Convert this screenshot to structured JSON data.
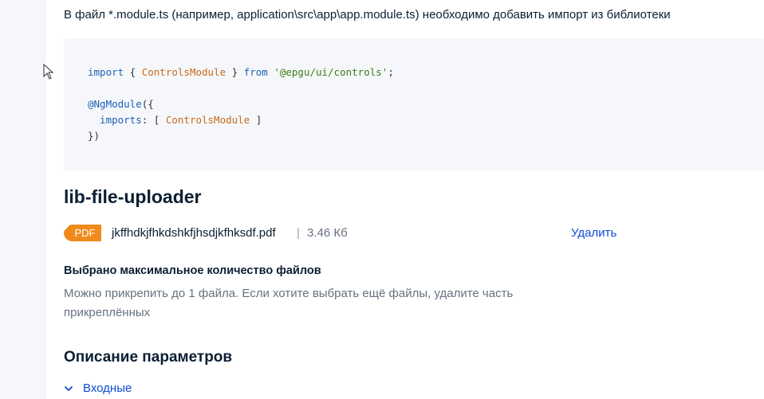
{
  "intro": {
    "text": "В файл *.module.ts (например, application\\src\\app\\app.module.ts) необходимо добавить импорт из библиотеки"
  },
  "code": {
    "line1": {
      "kw_import": "import",
      "brace_open": " { ",
      "class_name": "ControlsModule",
      "brace_close": " } ",
      "kw_from": "from",
      "space": " ",
      "module_path": "'@epgu/ui/controls'",
      "semicolon": ";"
    },
    "line3": {
      "decorator": "@NgModule",
      "rest": "({"
    },
    "line4": {
      "key": "  imports",
      "colon": ": [ ",
      "class_name": "ControlsModule",
      "bracket": " ]"
    },
    "line5": {
      "close": "})"
    }
  },
  "component": {
    "title": "lib-file-uploader"
  },
  "file": {
    "badge": "PDF",
    "name": "jkffhdkjfhkdshkfjhsdjkfhksdf.pdf",
    "separator": "|",
    "size": "3.46 Кб",
    "delete_label": "Удалить"
  },
  "limit": {
    "title": "Выбрано максимальное количество файлов",
    "text": "Можно прикрепить до 1 файла. Если хотите выбрать ещё файлы, удалите часть прикреплённых"
  },
  "params": {
    "title": "Описание параметров",
    "inputs_label": "Входные"
  },
  "colors": {
    "accent": "#0d4cd3",
    "badge": "#f08a1c",
    "code_bg": "#f5f7fa"
  }
}
